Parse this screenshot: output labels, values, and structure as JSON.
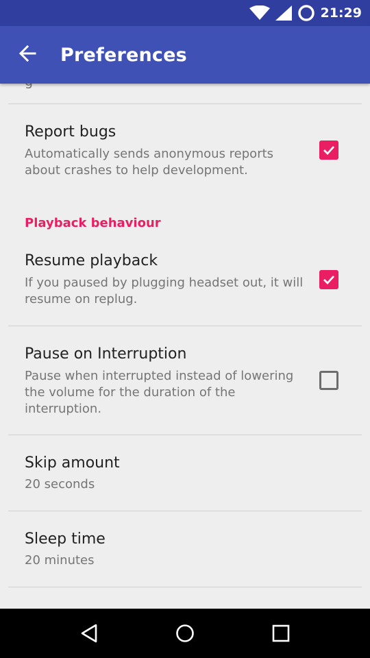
{
  "status_bar": {
    "time": "21:29",
    "icons": [
      "wifi-icon",
      "cell-signal-icon",
      "sync-circle-icon"
    ]
  },
  "app_bar": {
    "title": "Preferences",
    "back_icon": "arrow-back-icon"
  },
  "preferences": {
    "truncated_item_text": "g",
    "report_bugs": {
      "title": "Report bugs",
      "summary": "Automatically sends anonymous reports about crashes to help development.",
      "checked": true
    },
    "playback_category": "Playback behaviour",
    "resume_playback": {
      "title": "Resume playback",
      "summary": "If you paused by plugging headset out, it will resume on replug.",
      "checked": true
    },
    "pause_on_interruption": {
      "title": "Pause on Interruption",
      "summary": "Pause when interrupted instead of lowering the volume for the duration of the interruption.",
      "checked": false
    },
    "skip_amount": {
      "title": "Skip amount",
      "value": "20 seconds"
    },
    "sleep_time": {
      "title": "Sleep time",
      "value": "20 minutes"
    }
  },
  "nav_bar": {
    "icons": [
      "back-triangle-icon",
      "home-circle-icon",
      "recents-square-icon"
    ]
  },
  "colors": {
    "primary": "#3f51b5",
    "primary_dark": "#303f9f",
    "accent": "#e91e63",
    "background": "#eeeeee"
  }
}
